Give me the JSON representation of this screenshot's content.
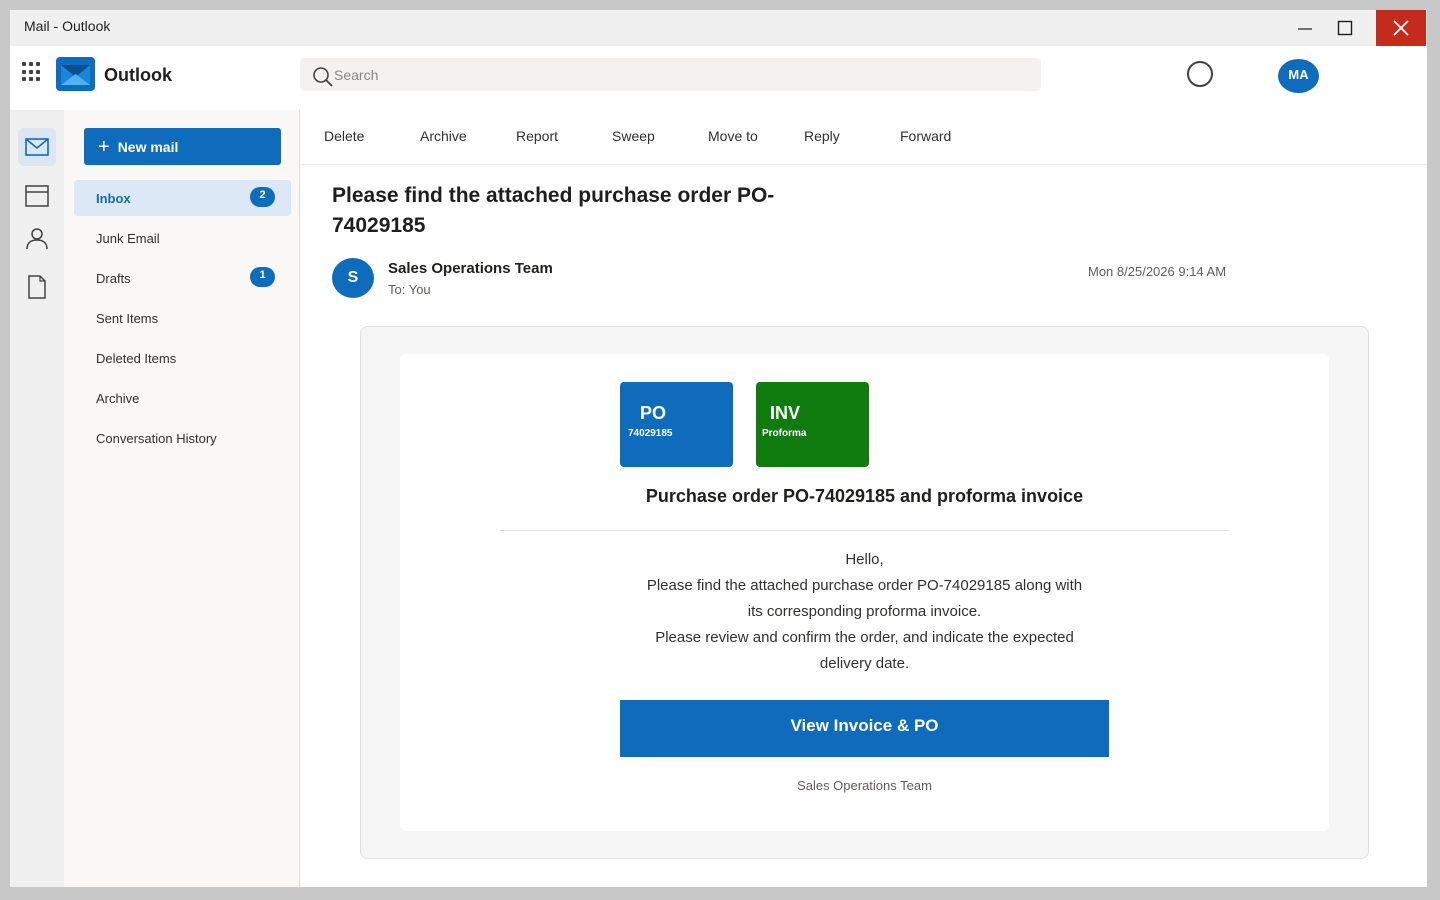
{
  "window": {
    "title": "Mail - Outlook"
  },
  "header": {
    "app_name": "Outlook",
    "search_placeholder": "Search",
    "user_initials": "MA"
  },
  "folders": {
    "new_mail_label": "New mail",
    "items": [
      {
        "label": "Inbox",
        "badge": "2",
        "active": true
      },
      {
        "label": "Junk Email"
      },
      {
        "label": "Drafts",
        "badge": "1"
      },
      {
        "label": "Sent Items"
      },
      {
        "label": "Deleted Items"
      },
      {
        "label": "Archive"
      },
      {
        "label": "Conversation History"
      }
    ]
  },
  "commands": [
    "Delete",
    "Archive",
    "Report",
    "Sweep",
    "Move to",
    "Reply",
    "Forward"
  ],
  "message": {
    "subject": "Please find the attached purchase order PO-74029185",
    "sender_initial": "S",
    "sender_name": "Sales Operations Team",
    "to": "To: You",
    "date": "Mon 8/25/2026 9:14 AM",
    "tiles": [
      {
        "big": "PO",
        "small": "74029185",
        "color": "#0f6cbd"
      },
      {
        "big": "INV",
        "small": "Proforma",
        "color": "#107c10"
      }
    ],
    "heading": "Purchase order PO-74029185 and proforma invoice",
    "body_lines": [
      "Hello,",
      "Please find the attached purchase order PO-74029185 along with",
      "its corresponding proforma invoice.",
      "Please review and confirm the order, and indicate the expected",
      "delivery date."
    ],
    "cta_label": "View Invoice & PO",
    "signature": "Sales Operations Team"
  },
  "colors": {
    "accent": "#0f6cbd",
    "close_button": "#c42b1c",
    "invoice_tile": "#107c10"
  },
  "icons": {
    "rail": [
      "mail-icon",
      "calendar-icon",
      "people-icon",
      "files-icon"
    ]
  }
}
